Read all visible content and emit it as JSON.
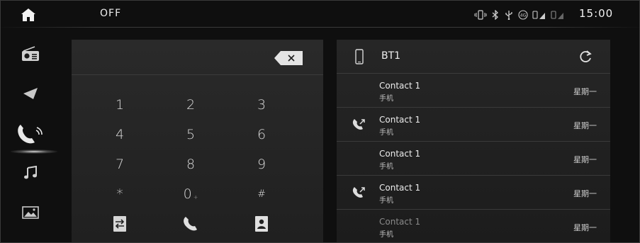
{
  "status_bar": {
    "ac_status": "OFF",
    "time": "15:00",
    "icons": [
      "vibrate-icon",
      "bluetooth-icon",
      "usb-icon",
      "4g-icon",
      "signal-sim1-icon",
      "signal-sim2-icon"
    ]
  },
  "nav": {
    "items": [
      {
        "name": "radio",
        "icon": "radio-icon",
        "active": false
      },
      {
        "name": "navigation",
        "icon": "navigation-arrow-icon",
        "active": false
      },
      {
        "name": "phone",
        "icon": "phone-icon",
        "active": true
      },
      {
        "name": "music",
        "icon": "music-note-icon",
        "active": false
      },
      {
        "name": "gallery",
        "icon": "image-icon",
        "active": false
      }
    ]
  },
  "dialpad": {
    "number": "",
    "keys": [
      "1",
      "2",
      "3",
      "4",
      "5",
      "6",
      "7",
      "8",
      "9",
      "*",
      "0",
      "#"
    ],
    "actions": [
      "transfer-icon",
      "call-icon",
      "contacts-book-icon"
    ]
  },
  "contacts": {
    "device_name": "BT1",
    "rows": [
      {
        "name": "Contact 1",
        "type": "手机",
        "day": "星期一",
        "icon": "",
        "dim": false
      },
      {
        "name": "Contact 1",
        "type": "手机",
        "day": "星期一",
        "icon": "missed-call-icon",
        "dim": false
      },
      {
        "name": "Contact 1",
        "type": "手机",
        "day": "星期一",
        "icon": "",
        "dim": false
      },
      {
        "name": "Contact 1",
        "type": "手机",
        "day": "星期一",
        "icon": "missed-call-icon",
        "dim": false
      },
      {
        "name": "Contact 1",
        "type": "手机",
        "day": "星期一",
        "icon": "",
        "dim": true
      }
    ]
  },
  "colors": {
    "background": "#0f0f0f",
    "panel": "#242424",
    "text": "#e6e6e6"
  }
}
